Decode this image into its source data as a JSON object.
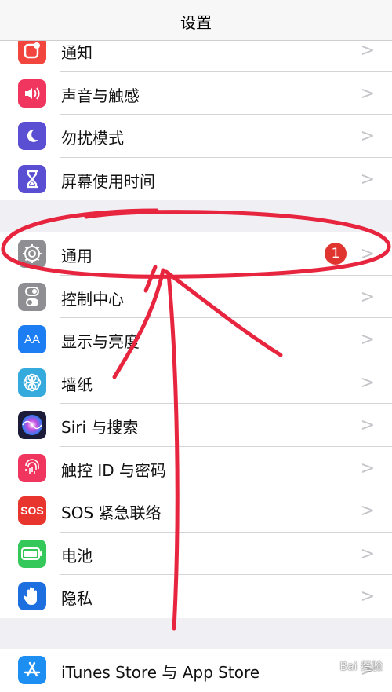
{
  "header": {
    "title": "设置"
  },
  "group1": [
    {
      "label": "通知",
      "icon": "notification-icon",
      "color": "#f2453d"
    },
    {
      "label": "声音与触感",
      "icon": "speaker-icon",
      "color": "#f0355e"
    },
    {
      "label": "勿扰模式",
      "icon": "moon-icon",
      "color": "#5a4fd2"
    },
    {
      "label": "屏幕使用时间",
      "icon": "hourglass-icon",
      "color": "#5a4fd2"
    }
  ],
  "group2": [
    {
      "label": "通用",
      "icon": "gear-icon",
      "color": "#8e8e93",
      "badge": "1"
    },
    {
      "label": "控制中心",
      "icon": "toggle-switch-icon",
      "color": "#8e8e93"
    },
    {
      "label": "显示与亮度",
      "icon": "text-size-icon",
      "color": "#1d7df2",
      "glyph": "AA"
    },
    {
      "label": "墙纸",
      "icon": "flower-icon",
      "color": "#35aadc"
    },
    {
      "label": "Siri 与搜索",
      "icon": "siri-icon",
      "color": "#1c1c3a"
    },
    {
      "label": "触控 ID 与密码",
      "icon": "fingerprint-icon",
      "color": "#f0355e"
    },
    {
      "label": "SOS 紧急联络",
      "icon": "sos-icon",
      "color": "#e8362f",
      "glyph": "SOS"
    },
    {
      "label": "电池",
      "icon": "battery-icon",
      "color": "#34c759"
    },
    {
      "label": "隐私",
      "icon": "hand-icon",
      "color": "#1d6fe0"
    }
  ],
  "group3": [
    {
      "label": "iTunes Store 与 App Store",
      "icon": "app-store-icon",
      "color": "#1d8ef2"
    }
  ],
  "chevron": ">",
  "annotation_color": "#e8253f",
  "watermark": "Bai 经验"
}
